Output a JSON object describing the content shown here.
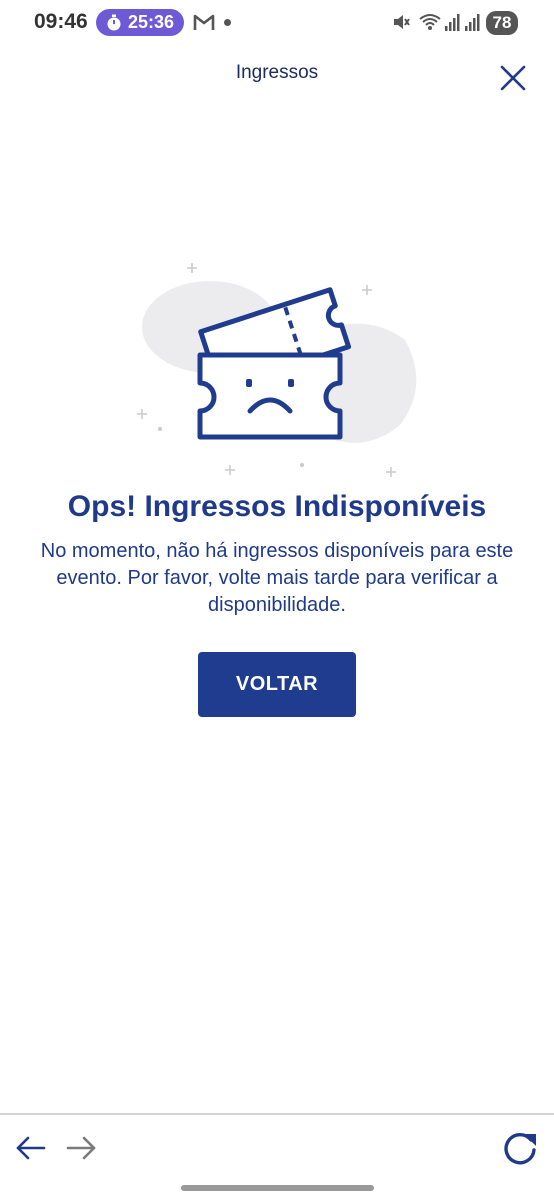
{
  "status_bar": {
    "time": "09:46",
    "timer": "25:36",
    "battery": "78",
    "icons": [
      "stopwatch-icon",
      "gmail-icon",
      "dot-icon",
      "mute-icon",
      "wifi-icon",
      "signal-icon",
      "signal-icon"
    ]
  },
  "header": {
    "title": "Ingressos",
    "close_icon": "close-icon"
  },
  "illustration": {
    "icon": "sad-ticket-icon"
  },
  "message": {
    "title": "Ops! Ingressos Indisponíveis",
    "body": "No momento, não há ingressos disponíveis para este evento. Por favor, volte mais tarde para verificar a disponibilidade."
  },
  "actions": {
    "back_label": "VOLTAR"
  },
  "bottom_nav": {
    "icons": [
      "arrow-left-icon",
      "arrow-right-icon",
      "refresh-icon"
    ]
  },
  "colors": {
    "primary": "#1f3c8f",
    "timer_pill": "#6f5ad6",
    "blob": "#ececee"
  }
}
